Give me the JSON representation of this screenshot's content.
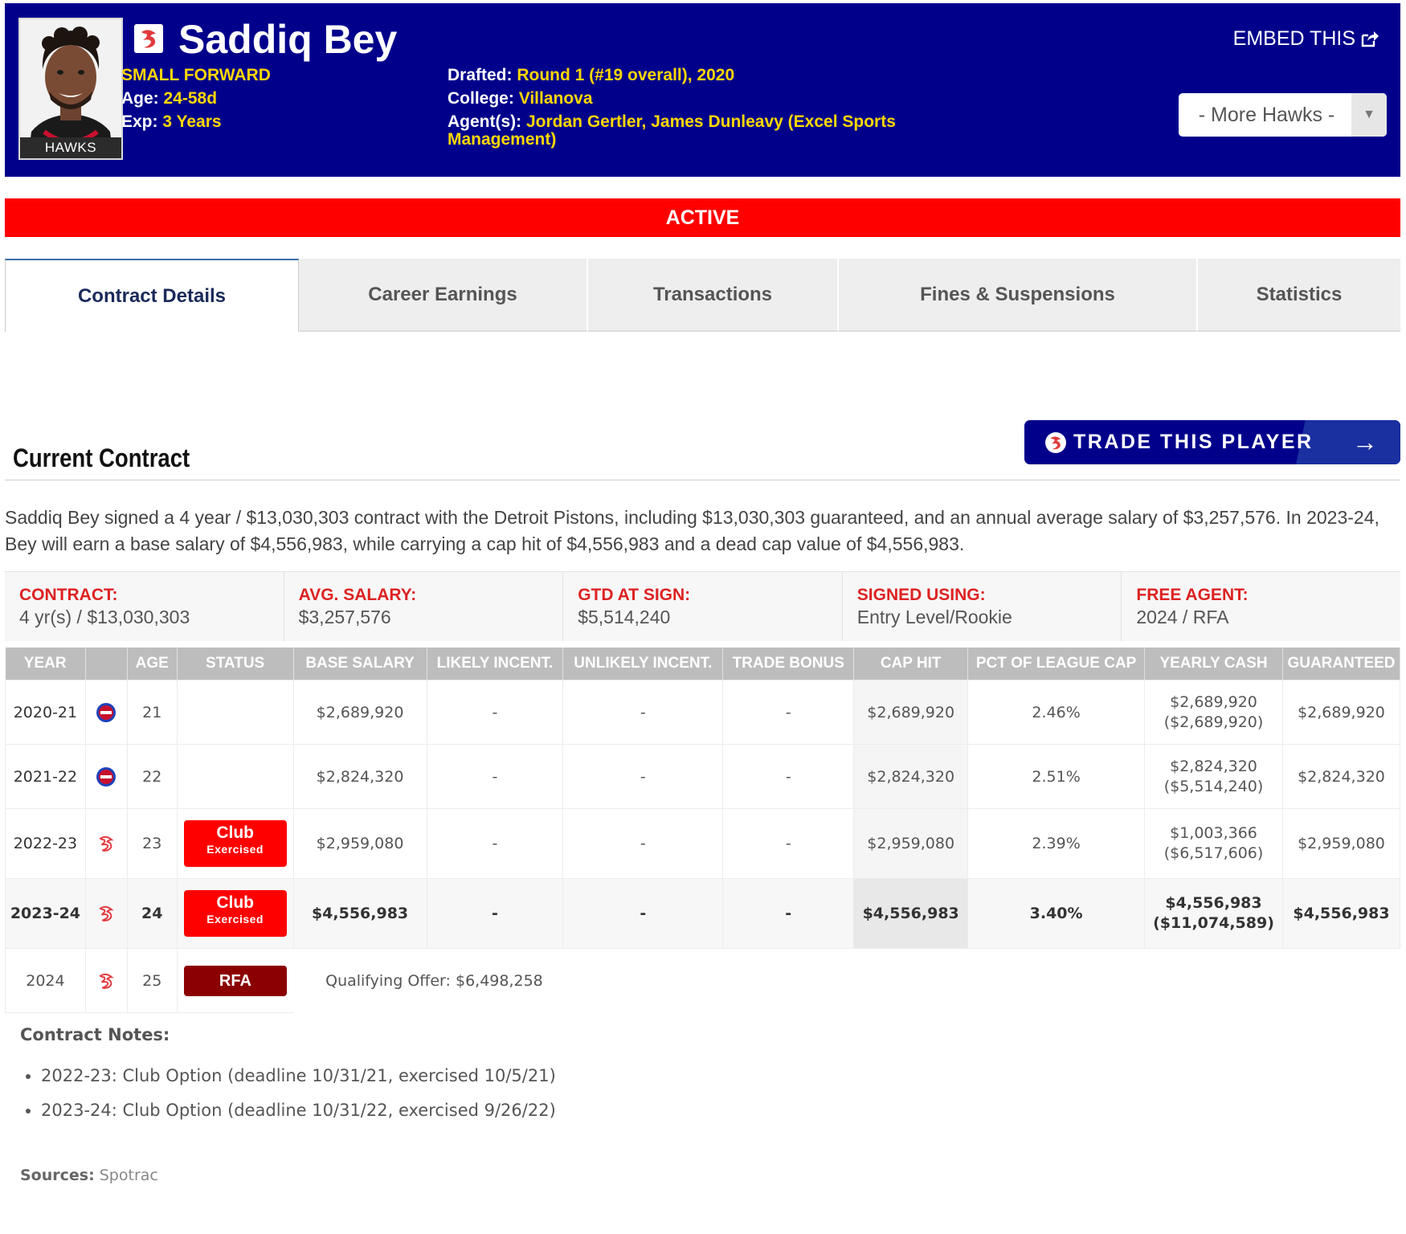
{
  "player": {
    "name": "Saddiq Bey",
    "photo_caption": "HAWKS",
    "position": "SMALL FORWARD",
    "age_label": "Age:",
    "age": "24-58d",
    "exp_label": "Exp:",
    "exp": "3 Years",
    "drafted_label": "Drafted:",
    "drafted": "Round 1 (#19 overall), 2020",
    "college_label": "College:",
    "college": "Villanova",
    "agents_label": "Agent(s):",
    "agents": "Jordan Gertler, James Dunleavy (Excel Sports Management)"
  },
  "header": {
    "embed_label": "EMBED THIS",
    "more_select": "- More Hawks -"
  },
  "status_banner": "ACTIVE",
  "tabs": [
    "Contract Details",
    "Career Earnings",
    "Transactions",
    "Fines & Suspensions",
    "Statistics"
  ],
  "section": {
    "title": "Current Contract",
    "trade_button": "TRADE THIS PLAYER",
    "summary": "Saddiq Bey signed a 4 year / $13,030,303 contract with the Detroit Pistons, including $13,030,303 guaranteed, and an annual average salary of $3,257,576. In 2023-24, Bey will earn a base salary of $4,556,983, while carrying a cap hit of $4,556,983 and a dead cap value of $4,556,983."
  },
  "stats": [
    {
      "label": "CONTRACT:",
      "value": "4 yr(s) / $13,030,303"
    },
    {
      "label": "AVG. SALARY:",
      "value": "$3,257,576"
    },
    {
      "label": "GTD AT SIGN:",
      "value": "$5,514,240"
    },
    {
      "label": "SIGNED USING:",
      "value": "Entry Level/Rookie"
    },
    {
      "label": "FREE AGENT:",
      "value": "2024 / RFA"
    }
  ],
  "table": {
    "headers": [
      "YEAR",
      "",
      "AGE",
      "STATUS",
      "BASE SALARY",
      "LIKELY INCENT.",
      "UNLIKELY INCENT.",
      "TRADE BONUS",
      "CAP HIT",
      "PCT OF LEAGUE CAP",
      "YEARLY CASH",
      "GUARANTEED"
    ],
    "rows": [
      {
        "year": "2020-21",
        "team": "pistons-logo",
        "age": "21",
        "status": "",
        "status_sub": "",
        "base": "$2,689,920",
        "likely": "-",
        "unlikely": "-",
        "trade": "-",
        "cap_hit": "$2,689,920",
        "pct": "2.46%",
        "cash": "$2,689,920",
        "cash_cum": "($2,689,920)",
        "gtd": "$2,689,920"
      },
      {
        "year": "2021-22",
        "team": "pistons-logo",
        "age": "22",
        "status": "",
        "status_sub": "",
        "base": "$2,824,320",
        "likely": "-",
        "unlikely": "-",
        "trade": "-",
        "cap_hit": "$2,824,320",
        "pct": "2.51%",
        "cash": "$2,824,320",
        "cash_cum": "($5,514,240)",
        "gtd": "$2,824,320"
      },
      {
        "year": "2022-23",
        "team": "hawks-logo",
        "age": "23",
        "status": "Club",
        "status_sub": "Exercised",
        "base": "$2,959,080",
        "likely": "-",
        "unlikely": "-",
        "trade": "-",
        "cap_hit": "$2,959,080",
        "pct": "2.39%",
        "cash": "$1,003,366",
        "cash_cum": "($6,517,606)",
        "gtd": "$2,959,080"
      },
      {
        "year": "2023-24",
        "team": "hawks-logo",
        "age": "24",
        "status": "Club",
        "status_sub": "Exercised",
        "base": "$4,556,983",
        "likely": "-",
        "unlikely": "-",
        "trade": "-",
        "cap_hit": "$4,556,983",
        "pct": "3.40%",
        "cash": "$4,556,983",
        "cash_cum": "($11,074,589)",
        "gtd": "$4,556,983"
      }
    ],
    "fa_row": {
      "year": "2024",
      "team": "hawks-logo",
      "age": "25",
      "status": "RFA",
      "note": "Qualifying Offer: $6,498,258"
    }
  },
  "notes": {
    "title": "Contract Notes:",
    "items": [
      "2022-23: Club Option (deadline 10/31/21, exercised 10/5/21)",
      "2023-24: Club Option (deadline 10/31/22, exercised 9/26/22)"
    ]
  },
  "sources": {
    "label": "Sources:",
    "value": "Spotrac"
  },
  "colors": {
    "header_bg": "#00008b",
    "accent_gold": "#ffd700",
    "active_red": "#ff0000",
    "rfa_red": "#8b0000"
  }
}
